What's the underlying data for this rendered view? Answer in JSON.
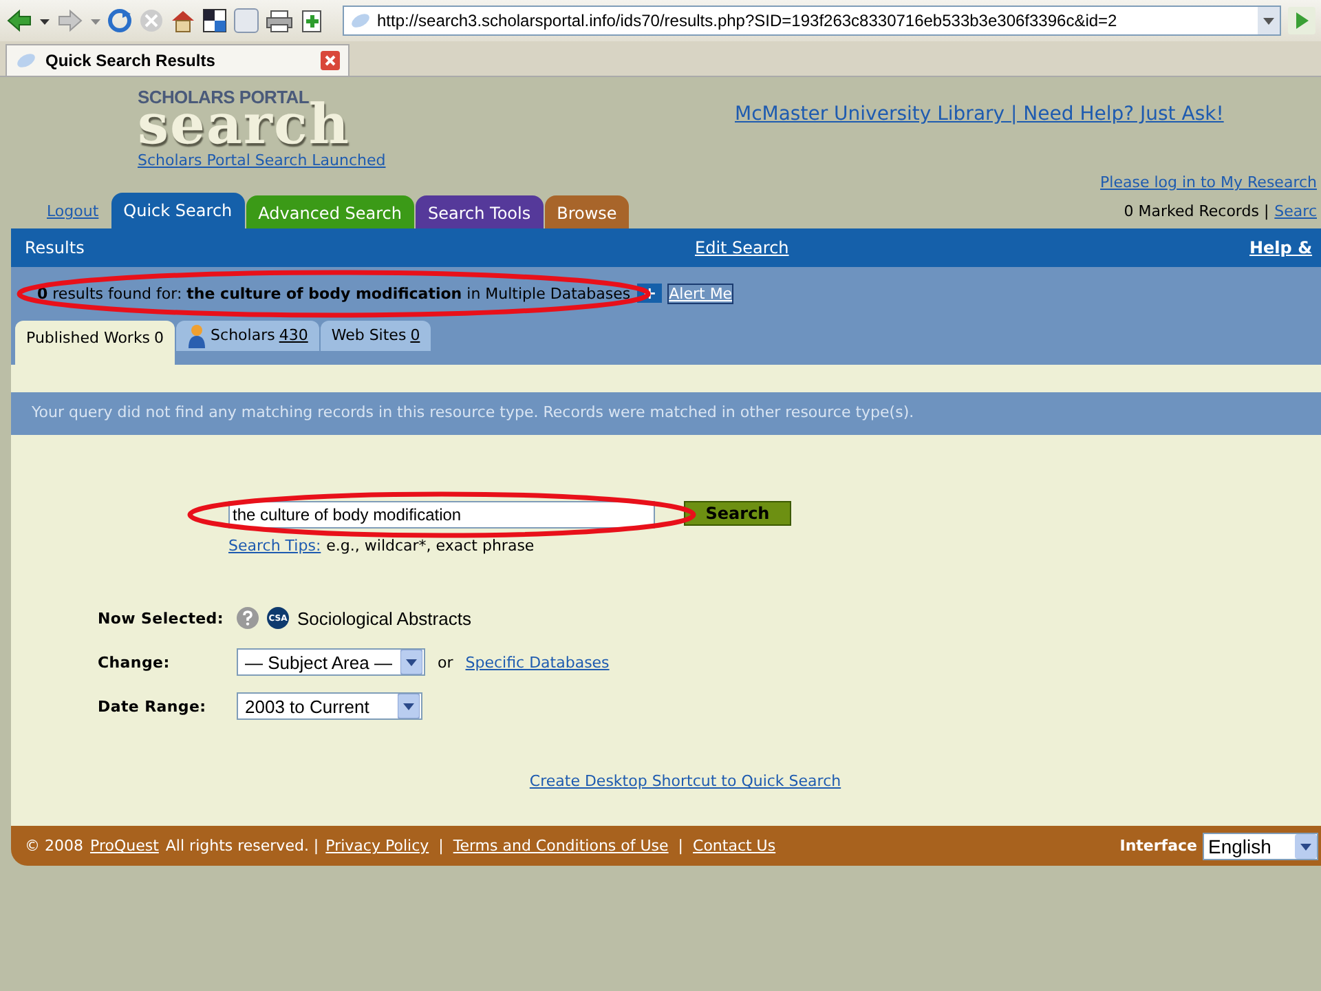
{
  "browser": {
    "address": "http://search3.scholarsportal.info/ids70/results.php?SID=193f263c8330716eb533b3e306f3396c&id=2",
    "tab_title": "Quick Search Results"
  },
  "header": {
    "logo_top": "SCHOLARS PORTAL",
    "logo_main": "search",
    "launch_link": "Scholars Portal Search Launched",
    "library_link": "McMaster University Library | Need Help? Just Ask!",
    "login_link": "Please log in to My Research",
    "marked_records": "0 Marked Records |",
    "search_link": "Searc"
  },
  "logout": "Logout",
  "nav_tabs": [
    {
      "label": "Quick Search",
      "selected": true,
      "color": "#1560aa"
    },
    {
      "label": "Advanced Search",
      "selected": false,
      "color": "#3b9a17"
    },
    {
      "label": "Search Tools",
      "selected": false,
      "color": "#55399a"
    },
    {
      "label": "Browse",
      "selected": false,
      "color": "#a8652a"
    }
  ],
  "results_bar": {
    "title": "Results",
    "edit_link": "Edit Search",
    "help_link": "Help &"
  },
  "summary": {
    "circled": true,
    "text": "**0** results found for: **the culture of body modification** in Multiple Databases",
    "plus": "+",
    "alert_link": "Alert Me"
  },
  "result_tabs": [
    {
      "label": "Published Works",
      "count": "0",
      "selected": true,
      "icon": false
    },
    {
      "label": "Scholars",
      "count": "430",
      "selected": false,
      "icon": true
    },
    {
      "label": "Web Sites",
      "count": "0",
      "selected": false,
      "icon": false
    }
  ],
  "message": "Your query did not find any matching records in this resource type. Records were matched in other resource type(s).",
  "form": {
    "query": "the culture of body modification",
    "query_circled": true,
    "search_button": "Search",
    "tips_link": "Search Tips:",
    "tips_text": "e.g., wildcar*, exact phrase",
    "now_selected_label": "Now Selected:",
    "database": "Sociological Abstracts",
    "csa_badge": "CSA",
    "change_label": "Change:",
    "subject_select": "— Subject Area —",
    "or": "or",
    "databases_link": "Specific Databases",
    "date_label": "Date Range:",
    "date_select": "2003 to Current",
    "shortcut_link": "Create Desktop Shortcut to Quick Search"
  },
  "footer": {
    "copyright": "© 2008",
    "proquest_link": "ProQuest",
    "rights": "All rights reserved. |",
    "links": [
      "Privacy Policy",
      "Terms and Conditions of Use",
      "Contact Us"
    ],
    "separators": [
      "|",
      "|"
    ],
    "interface_label": "Interface",
    "language": "English"
  }
}
